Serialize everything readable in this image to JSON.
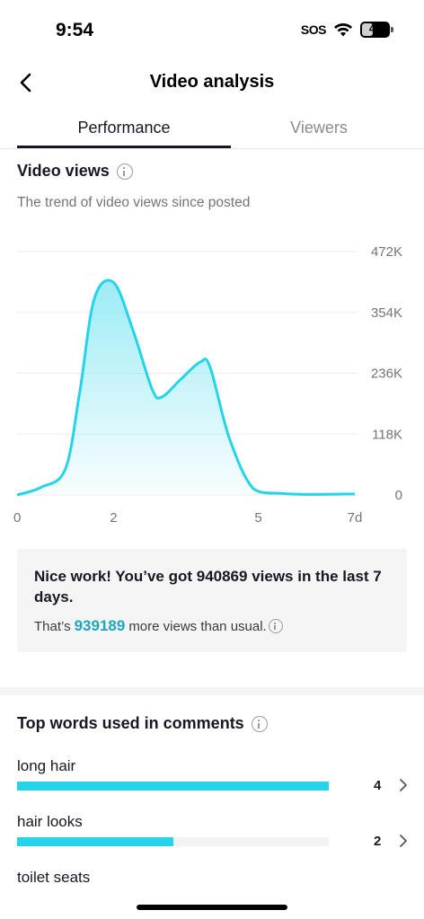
{
  "status_bar": {
    "time": "9:54",
    "sos": "SOS",
    "battery": "40",
    "battery_level": 0.4
  },
  "header": {
    "title": "Video analysis",
    "back_icon": "chevron-left-icon"
  },
  "tabs": [
    {
      "label": "Performance",
      "active": true
    },
    {
      "label": "Viewers",
      "active": false
    }
  ],
  "video_views": {
    "title": "Video views",
    "subtitle": "The trend of video views since posted"
  },
  "chart_data": {
    "type": "area",
    "x_ticks": [
      "0",
      "2",
      "5",
      "7d"
    ],
    "x_tick_values": [
      0,
      2,
      5,
      7
    ],
    "y_ticks": [
      "0",
      "118K",
      "236K",
      "354K",
      "472K"
    ],
    "y_tick_values": [
      0,
      118000,
      236000,
      354000,
      472000
    ],
    "xlim": [
      0,
      7
    ],
    "ylim": [
      0,
      472000
    ],
    "series": [
      {
        "x": [
          0,
          0.5,
          1,
          1.3,
          1.6,
          2,
          2.4,
          2.8,
          3,
          3.4,
          3.8,
          4,
          4.4,
          4.9,
          5.5,
          6,
          7
        ],
        "values": [
          0,
          15000,
          50000,
          200000,
          380000,
          412000,
          320000,
          205000,
          190000,
          225000,
          258000,
          248000,
          110000,
          12000,
          3000,
          1000,
          2000
        ]
      }
    ],
    "color": "#25d4e8",
    "grid": true
  },
  "summary_card": {
    "headline": "Nice work! You’ve got 940869 views in the last 7 days.",
    "note_prefix": "That’s",
    "note_number": "939189",
    "note_suffix": "more views than usual."
  },
  "top_words": {
    "title": "Top words used in comments",
    "items": [
      {
        "word": "long hair",
        "count": "4",
        "fraction": 1.0
      },
      {
        "word": "hair looks",
        "count": "2",
        "fraction": 0.5
      },
      {
        "word": "toilet seats",
        "count": "",
        "fraction": 0
      }
    ]
  },
  "colors": {
    "accent": "#25d4e8",
    "accent_text": "#1ea6bd"
  }
}
